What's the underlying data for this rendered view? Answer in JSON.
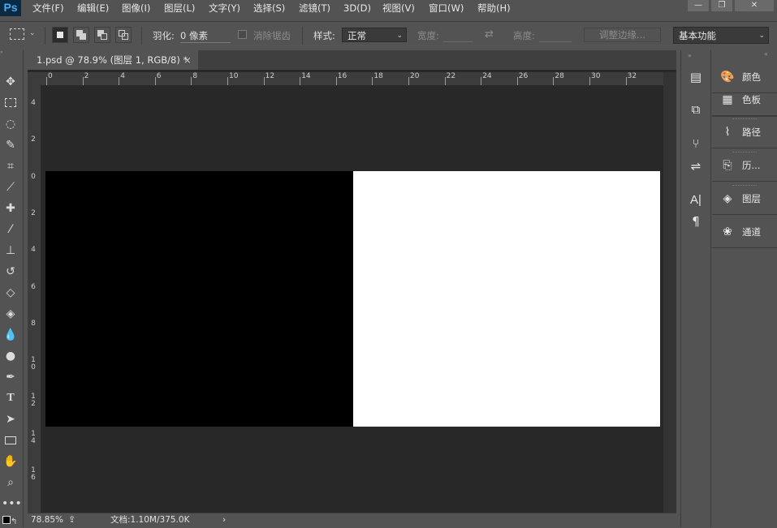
{
  "app": {
    "logo": "Ps"
  },
  "menu": [
    "文件(F)",
    "编辑(E)",
    "图像(I)",
    "图层(L)",
    "文字(Y)",
    "选择(S)",
    "滤镜(T)",
    "3D(D)",
    "视图(V)",
    "窗口(W)",
    "帮助(H)"
  ],
  "window_controls": {
    "minimize": "—",
    "restore": "❐",
    "close": "✕"
  },
  "options": {
    "feather_label": "羽化:",
    "feather_value": "0 像素",
    "antialias_label": "消除锯齿",
    "style_label": "样式:",
    "style_value": "正常",
    "width_label": "宽度:",
    "height_label": "高度:",
    "refine_edge": "调整边缘...",
    "workspace": "基本功能"
  },
  "document": {
    "tab_title": "1.psd @ 78.9% (图层 1, RGB/8) *",
    "close": "×"
  },
  "ruler": {
    "h_ticks": [
      "0",
      "2",
      "4",
      "6",
      "8",
      "10",
      "12",
      "14",
      "16",
      "18",
      "20",
      "22",
      "24",
      "26",
      "28",
      "30",
      "32"
    ],
    "v_ticks": [
      "4",
      "2",
      "0",
      "2",
      "4",
      "6",
      "8",
      "10",
      "12",
      "14",
      "16"
    ]
  },
  "status": {
    "zoom": "78.85%",
    "doc_info": "文档:1.10M/375.0K",
    "arrow": "›"
  },
  "panels": [
    {
      "icon": "palette-icon",
      "label": "颜色"
    },
    {
      "icon": "swatches-icon",
      "label": "色板"
    },
    {
      "icon": "paths-icon",
      "label": "路径"
    },
    {
      "icon": "history-icon",
      "label": "历..."
    },
    {
      "icon": "layers-icon",
      "label": "图层"
    },
    {
      "icon": "channels-icon",
      "label": "通道"
    }
  ],
  "colors": {
    "bg": "#535353",
    "canvas_bg": "#282828",
    "left_fill": "#000000",
    "right_fill": "#ffffff"
  }
}
